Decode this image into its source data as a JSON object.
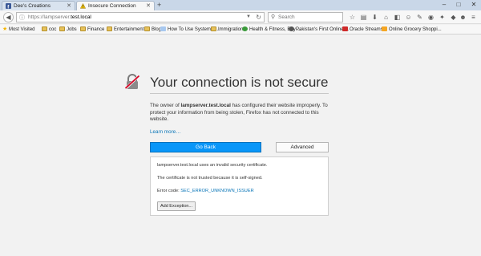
{
  "tabs": [
    {
      "label": "Dee's Creations",
      "active": false
    },
    {
      "label": "Insecure Connection",
      "active": true
    }
  ],
  "window_controls": {
    "minimize": "–",
    "maximize": "□",
    "close": "✕"
  },
  "urlbar": {
    "scheme": "https://",
    "host_prefix": "lampserver.",
    "host": "test.local"
  },
  "search": {
    "placeholder": "Search"
  },
  "bookmarks": [
    {
      "label": "Most Visited",
      "icon": "star-icon"
    },
    {
      "label": "coc",
      "icon": "folder-icon"
    },
    {
      "label": "Jobs",
      "icon": "folder-icon"
    },
    {
      "label": "Finance",
      "icon": "folder-icon"
    },
    {
      "label": "Entertainment",
      "icon": "folder-icon"
    },
    {
      "label": "Blog",
      "icon": "folder-icon"
    },
    {
      "label": "How To Use Systemctl...",
      "icon": "cloud-icon"
    },
    {
      "label": "Immigration",
      "icon": "folder-icon"
    },
    {
      "label": "Health & Fitness, Buy ...",
      "icon": "site-icon"
    },
    {
      "label": "Pakistan's First Online ...",
      "icon": "site-icon"
    },
    {
      "label": "Oracle Streams",
      "icon": "oracle-icon"
    },
    {
      "label": "Online Grocery Shoppi...",
      "icon": "shop-icon"
    }
  ],
  "error": {
    "title": "Your connection is not secure",
    "desc_prefix": "The owner of ",
    "desc_host": "lampserver.test.local",
    "desc_suffix": " has configured their website improperly. To protect your information from being stolen, Firefox has not connected to this website.",
    "learn_more": "Learn more…",
    "go_back": "Go Back",
    "advanced": "Advanced"
  },
  "advanced_panel": {
    "line1": "lampserver.test.local uses an invalid security certificate.",
    "line2": "The certificate is not trusted because it is self-signed.",
    "code_label": "Error code: ",
    "code": "SEC_ERROR_UNKNOWN_ISSUER",
    "add_exception": "Add Exception..."
  },
  "colors": {
    "accent": "#0996f8",
    "link": "#0a76b8"
  }
}
